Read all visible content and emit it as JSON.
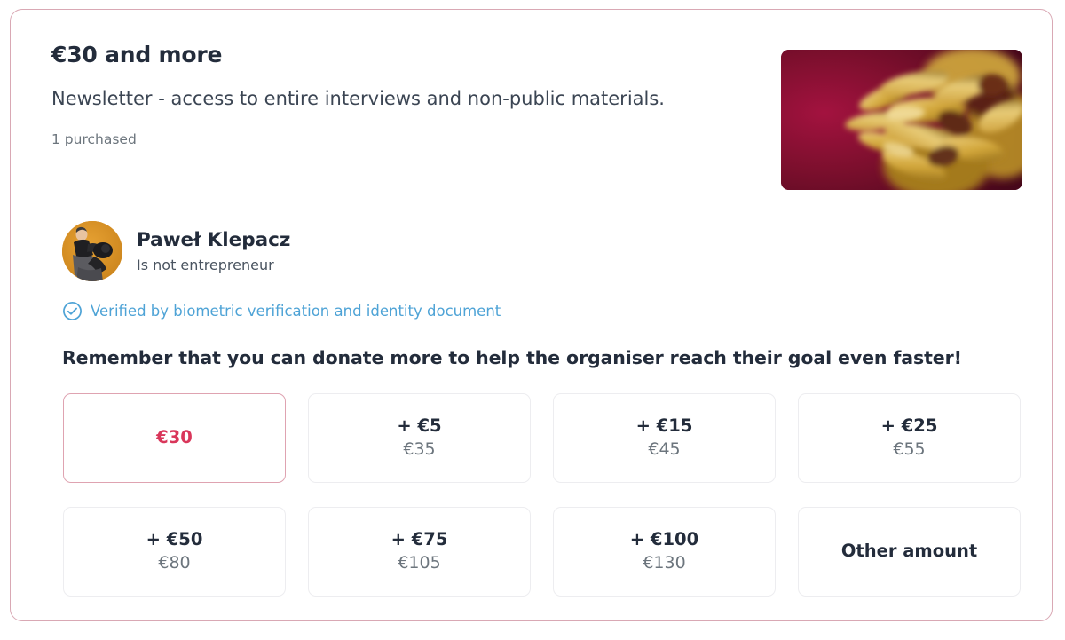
{
  "reward": {
    "title": "€30 and more",
    "description": "Newsletter - access to entire interviews and non-public materials.",
    "purchased": "1 purchased",
    "thumbnail_alt": "flower-macro-photo"
  },
  "organiser": {
    "name": "Paweł Klepacz",
    "role": "Is not entrepreneur",
    "avatar_alt": "organiser-avatar-photo",
    "verified_text": "Verified by biometric verification and identity document",
    "verified_color": "#4ea3d6"
  },
  "donate": {
    "prompt": "Remember that you can donate more to help the organiser reach their goal even faster!",
    "selected_index": 0,
    "selected_color": "#d9365a",
    "options": [
      {
        "top": "€30",
        "sub": "",
        "selected": true
      },
      {
        "top": "+ €5",
        "sub": "€35",
        "selected": false
      },
      {
        "top": "+ €15",
        "sub": "€45",
        "selected": false
      },
      {
        "top": "+ €25",
        "sub": "€55",
        "selected": false
      },
      {
        "top": "+ €50",
        "sub": "€80",
        "selected": false
      },
      {
        "top": "+ €75",
        "sub": "€105",
        "selected": false
      },
      {
        "top": "+ €100",
        "sub": "€130",
        "selected": false
      },
      {
        "top": "Other amount",
        "sub": "",
        "selected": false
      }
    ]
  },
  "theme": {
    "card_border": "#d9a8b4",
    "text_dark": "#232c3b",
    "text_muted": "#6c757d"
  }
}
